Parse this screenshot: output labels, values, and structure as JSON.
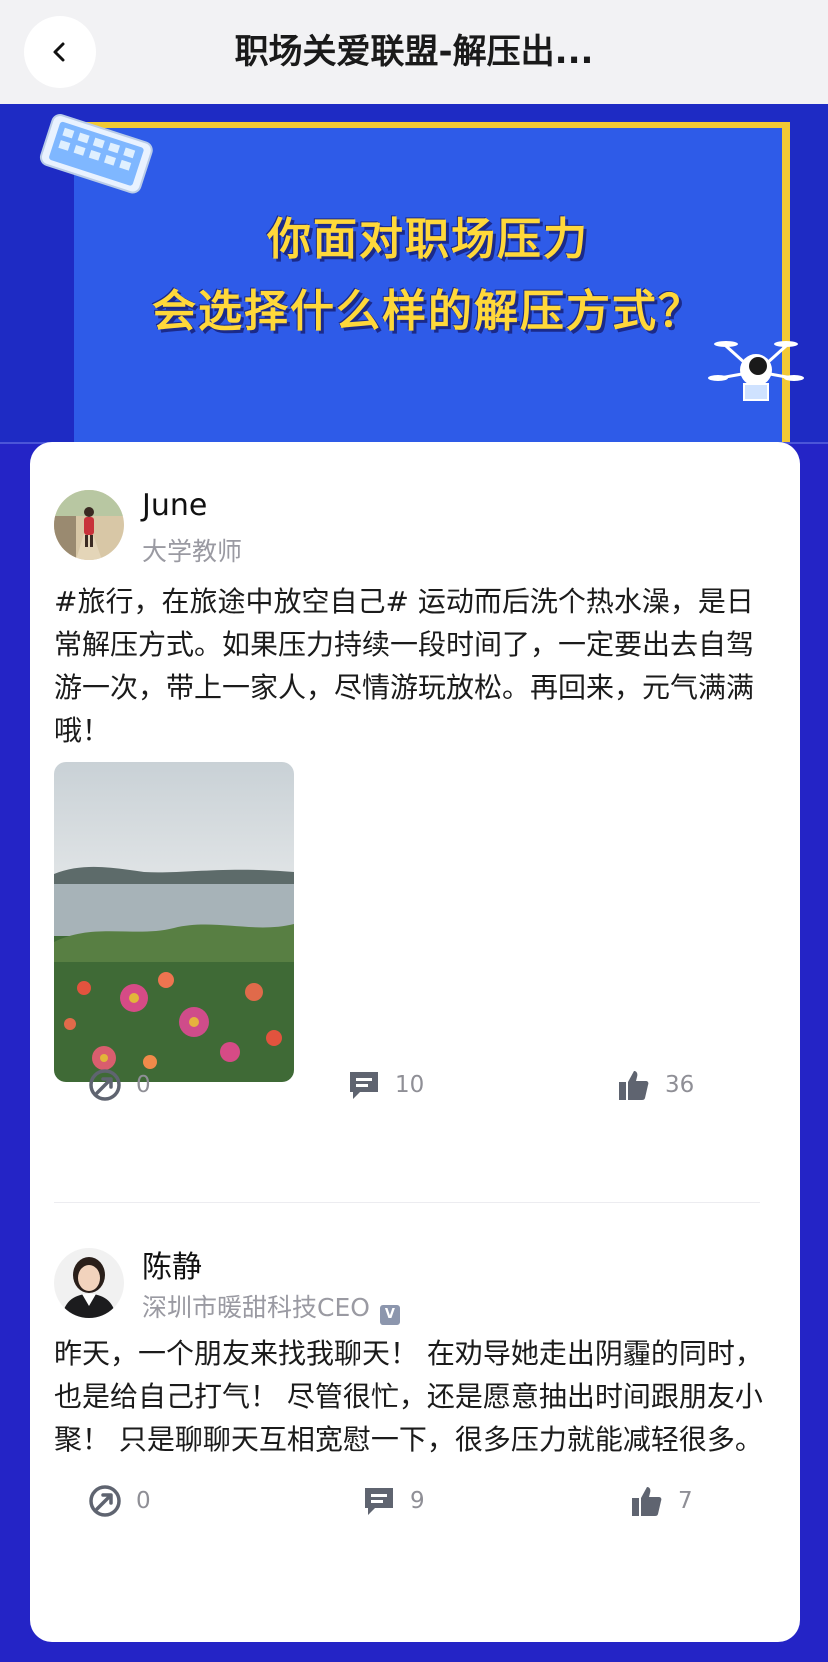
{
  "header": {
    "title": "职场关爱联盟-解压出..."
  },
  "banner": {
    "line1": "你面对职场压力",
    "line2": "会选择什么样的解压方式？"
  },
  "posts": [
    {
      "author": "June",
      "subtitle": "大学教师",
      "text": "#旅行，在旅途中放空自己# 运动而后洗个热水澡，是日常解压方式。如果压力持续一段时间了，一定要出去自驾游一次，带上一家人，尽情游玩放松。再回来，元气满满哦！",
      "share_count": "0",
      "comment_count": "10",
      "like_count": "36"
    },
    {
      "author": "陈静",
      "subtitle": "深圳市暖甜科技CEO",
      "text": "昨天，一个朋友来找我聊天！ 在劝导她走出阴霾的同时，也是给自己打气！ 尽管很忙，还是愿意抽出时间跟朋友小聚！ 只是聊聊天互相宽慰一下，很多压力就能减轻很多。",
      "share_count": "0",
      "comment_count": "9",
      "like_count": "7"
    }
  ],
  "icons": {
    "back": "chevron-left-icon",
    "share": "share-icon",
    "comment": "comment-icon",
    "like": "thumbs-up-icon",
    "verified": "verified-badge-icon"
  },
  "colors": {
    "page_background": "#2424c6",
    "banner_text": "#ffd83a",
    "muted_text": "#9a9aa2"
  }
}
